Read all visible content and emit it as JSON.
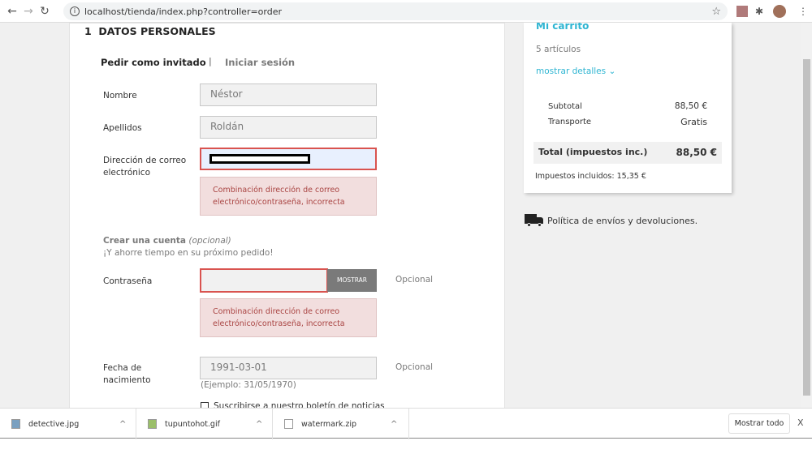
{
  "browser": {
    "url": "localhost/tienda/index.php?controller=order"
  },
  "form": {
    "section_number": "1",
    "section_title": "DATOS PERSONALES",
    "tab_guest": "Pedir como invitado",
    "separator": "|",
    "tab_login": "Iniciar sesión",
    "name_label": "Nombre",
    "name_value": "Néstor",
    "surname_label": "Apellidos",
    "surname_value": "Roldán",
    "email_label": "Dirección de correo electrónico",
    "email_error": "Combinación dirección de correo electrónico/contraseña, incorrecta",
    "create_account": "Crear una cuenta",
    "optional_paren": "(opcional)",
    "save_time": "¡Y ahorre tiempo en su próximo pedido!",
    "password_label": "Contraseña",
    "show_button": "MOSTRAR",
    "optional": "Opcional",
    "password_error": "Combinación dirección de correo electrónico/contraseña, incorrecta",
    "birthdate_label": "Fecha de nacimiento",
    "birthdate_value": "1991-03-01",
    "birthdate_example": "(Ejemplo: 31/05/1970)",
    "newsletter": "Suscribirse a nuestro boletín de noticias"
  },
  "cart": {
    "title": "Mi carrito",
    "items": "5 artículos",
    "details": "mostrar detalles",
    "subtotal_label": "Subtotal",
    "subtotal": "88,50 €",
    "shipping_label": "Transporte",
    "shipping": "Gratis",
    "total_label": "Total (impuestos inc.)",
    "total": "88,50 €",
    "taxes": "Impuestos incluidos: 15,35 €",
    "policy": "Política de envíos y devoluciones."
  },
  "downloads": {
    "items": [
      "detective.jpg",
      "tupuntohot.gif",
      "watermark.zip"
    ],
    "show_all": "Mostrar todo",
    "close": "X"
  },
  "colors": {
    "accent": "#2fb5d2",
    "error": "#a94442",
    "error_border": "#d9534f"
  }
}
